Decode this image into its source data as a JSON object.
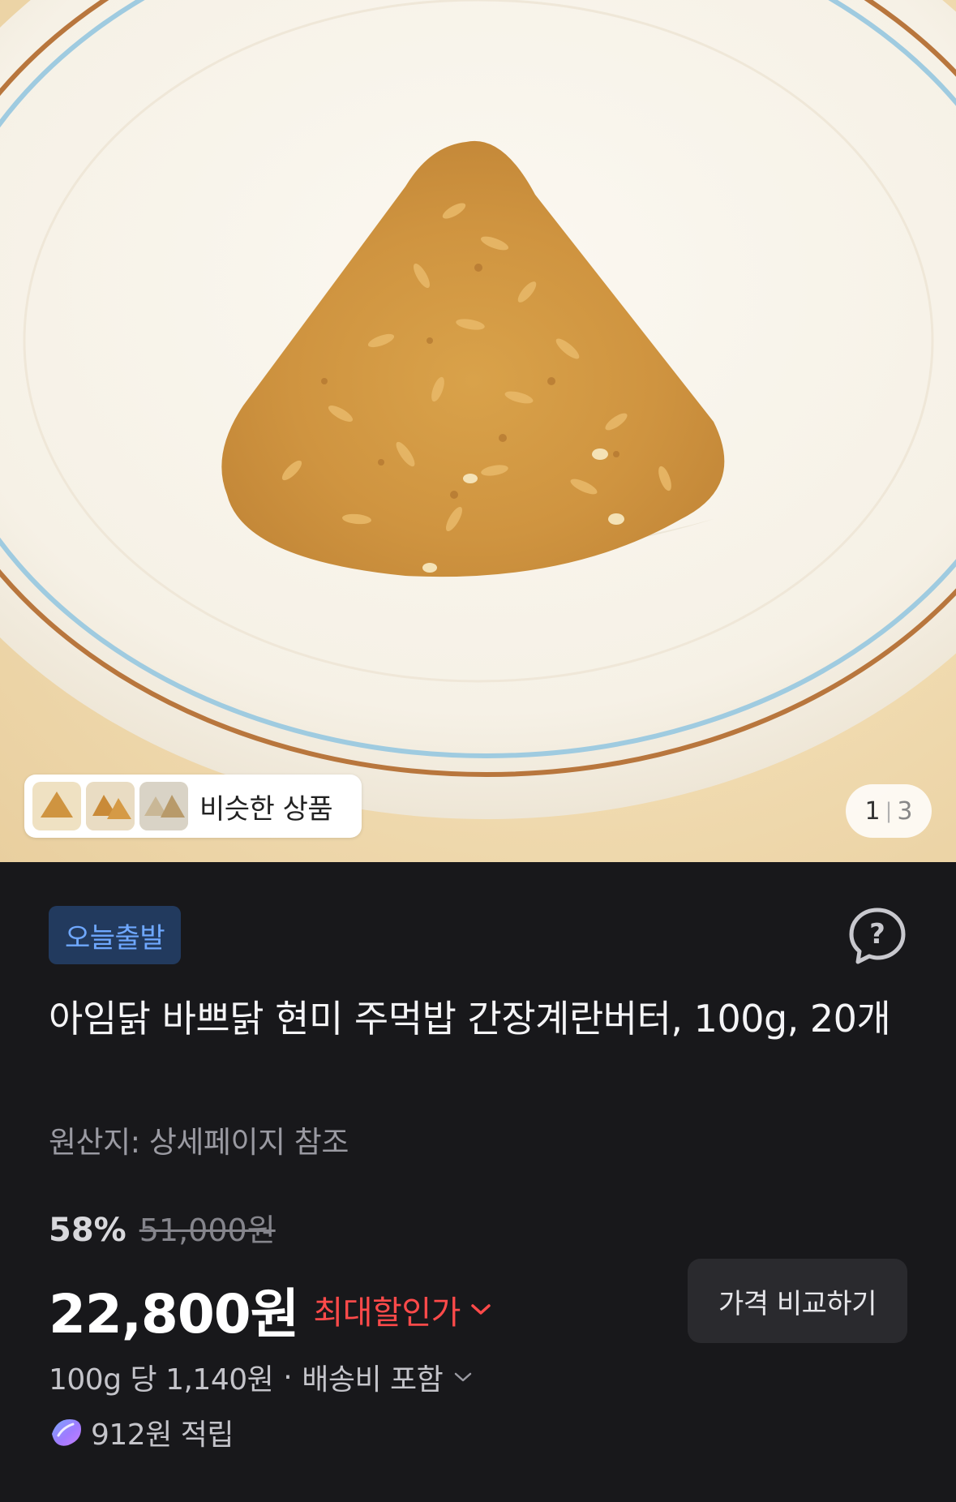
{
  "gallery": {
    "similar_label": "비슷한 상품",
    "current_page": "1",
    "separator": "|",
    "total_pages": "3"
  },
  "product": {
    "badge": "오늘출발",
    "title": "아임닭 바쁘닭 현미 주먹밥 간장계란버터, 100g, 20개",
    "origin": "원산지: 상세페이지 참조"
  },
  "price": {
    "discount_percent": "58%",
    "original_price": "51,000원",
    "sale_price": "22,800원",
    "max_discount_label": "최대할인가",
    "compare_button": "가격 비교하기",
    "unit_price": "100g 당 1,140원",
    "dot": "·",
    "shipping": "배송비 포함",
    "points": "912원 적립"
  },
  "colors": {
    "badge_bg": "#223a5e",
    "badge_text": "#6fa8ff",
    "max_discount": "#ff4a4a",
    "background": "#18181b"
  },
  "icons": {
    "help": "question-bubble-icon",
    "chevron": "chevron-down-icon",
    "points": "points-icon"
  }
}
